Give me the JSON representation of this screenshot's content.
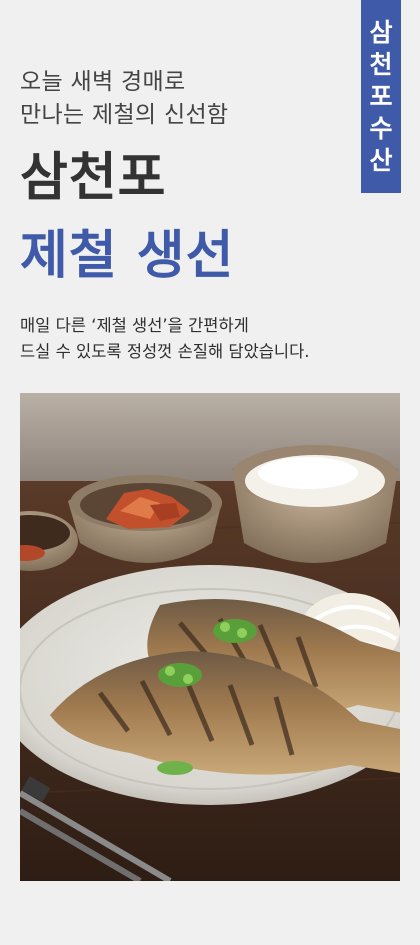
{
  "badge": {
    "chars": [
      "삼",
      "천",
      "포",
      "수",
      "산"
    ]
  },
  "intro": {
    "line1": "오늘 새벽 경매로",
    "line2": "만나는 제철의 신선함"
  },
  "title": {
    "line1": "삼천포",
    "line2": "제철 생선"
  },
  "description": {
    "line1": "매일 다른 ‘제철 생선’을 간편하게",
    "line2": "드실 수 있도록 정성껏 손질해 담았습니다."
  },
  "colors": {
    "accent": "#3f5aa8",
    "background": "#f0f0f0",
    "text": "#333333"
  },
  "photo": {
    "subject": "grilled-mackerel-meal-photo"
  }
}
